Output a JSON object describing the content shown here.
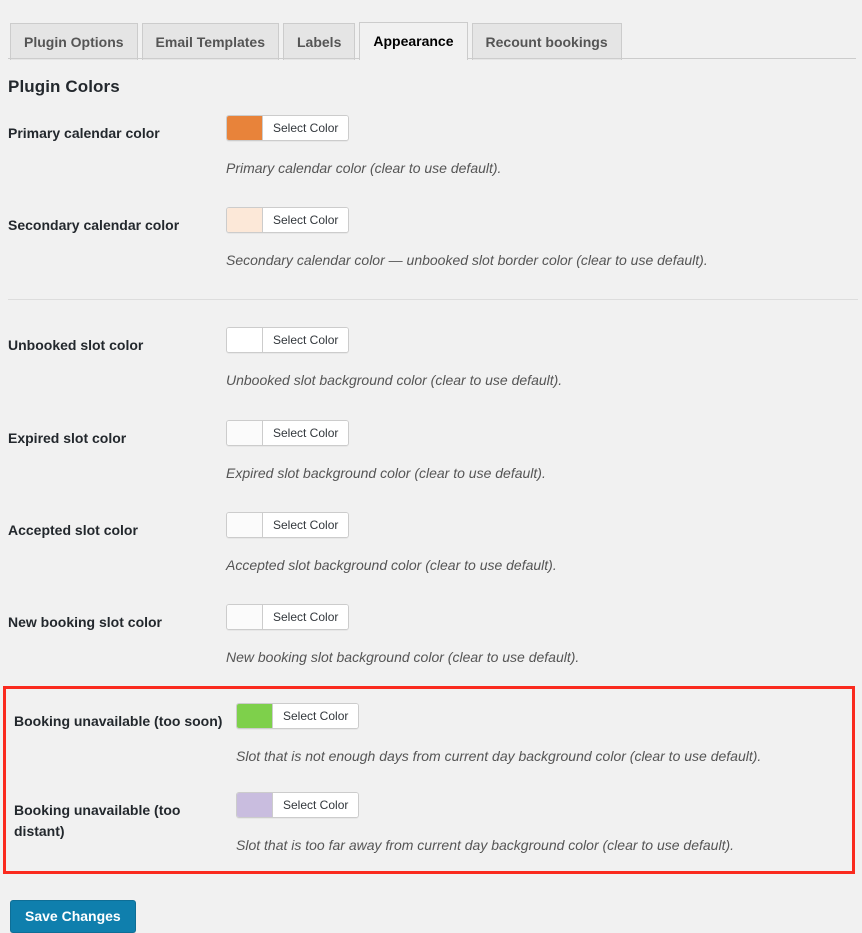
{
  "tabs": [
    {
      "label": "Plugin Options",
      "active": false,
      "name": "tab-plugin-options"
    },
    {
      "label": "Email Templates",
      "active": false,
      "name": "tab-email-templates"
    },
    {
      "label": "Labels",
      "active": false,
      "name": "tab-labels"
    },
    {
      "label": "Appearance",
      "active": true,
      "name": "tab-appearance"
    },
    {
      "label": "Recount bookings",
      "active": false,
      "name": "tab-recount-bookings"
    }
  ],
  "heading": "Plugin Colors",
  "pick_button_label": "Select Color",
  "rows": [
    {
      "label": "Primary calendar color",
      "description": "Primary calendar color (clear to use default).",
      "swatch": "#E8833A",
      "name": "primary-calendar-color"
    },
    {
      "label": "Secondary calendar color",
      "description": "Secondary calendar color — unbooked slot border color (clear to use default).",
      "swatch": "#FCE8D8",
      "name": "secondary-calendar-color"
    },
    {
      "label": "Unbooked slot color",
      "description": "Unbooked slot background color (clear to use default).",
      "swatch": "#FFFFFF",
      "name": "unbooked-slot-color"
    },
    {
      "label": "Expired slot color",
      "description": "Expired slot background color (clear to use default).",
      "swatch": "#FBFBFB",
      "name": "expired-slot-color"
    },
    {
      "label": "Accepted slot color",
      "description": "Accepted slot background color (clear to use default).",
      "swatch": "#FBFBFB",
      "name": "accepted-slot-color"
    },
    {
      "label": "New booking slot color",
      "description": "New booking slot background color (clear to use default).",
      "swatch": "#FBFBFB",
      "name": "new-booking-slot-color"
    }
  ],
  "highlighted_rows": [
    {
      "label": "Booking unavailable (too soon)",
      "description": "Slot that is not enough days from current day background color (clear to use default).",
      "swatch": "#7ED04B",
      "name": "booking-unavailable-too-soon"
    },
    {
      "label": "Booking unavailable (too distant)",
      "description": "Slot that is too far away from current day background color (clear to use default).",
      "swatch": "#C9BDDF",
      "name": "booking-unavailable-too-distant"
    }
  ],
  "save_label": "Save Changes",
  "colors": {
    "highlight_border": "#FA2A1E",
    "primary_button": "#0F7FAD",
    "page_background": "#F1F1F1",
    "separator": "#DDDDDD"
  }
}
